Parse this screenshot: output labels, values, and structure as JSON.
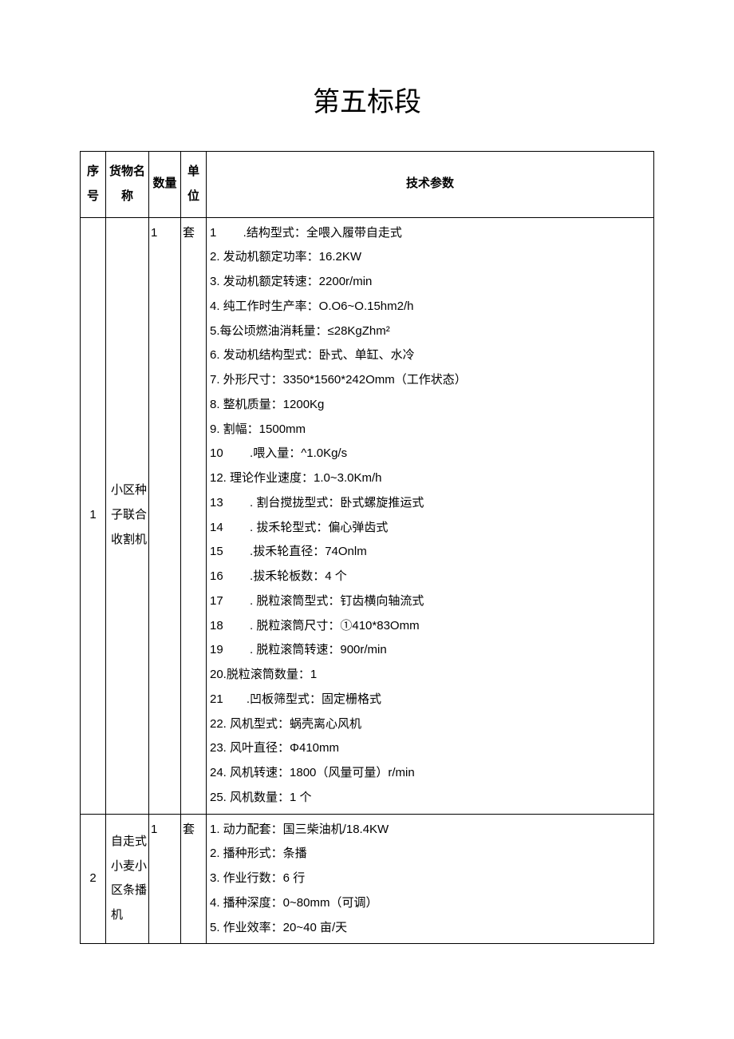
{
  "title": "第五标段",
  "headers": {
    "seq": "序号",
    "name": "货物名称",
    "qty": "数量",
    "unit": "单位",
    "spec": "技术参数"
  },
  "rows": [
    {
      "seq": "1",
      "name": "小区种子联合收割机",
      "qty": "1",
      "unit": "套",
      "specs": [
        "1        .结构型式：全喂入履带自走式",
        "2. 发动机额定功率：16.2KW",
        "3. 发动机额定转速：2200r/min",
        "4. 纯工作时生产率：O.O6~O.15hm2/h",
        "5.每公顷燃油消耗量：≤28KgZhm²",
        "6. 发动机结构型式：卧式、单缸、水冷",
        "7. 外形尺寸：3350*1560*242Omm（工作状态）",
        "8. 整机质量：1200Kg",
        "9. 割幅：1500mm",
        "10        .喂入量：^1.0Kg/s",
        "12. 理论作业速度：1.0~3.0Km/h",
        "13        . 割台搅拢型式：卧式螺旋推运式",
        "14        . 拔禾轮型式：偏心弹齿式",
        "15        .拔禾轮直径：74Onlm",
        "16        .拔禾轮板数：4 个",
        "17        . 脱粒滚筒型式：钉齿横向轴流式",
        "18        . 脱粒滚筒尺寸：①410*83Omm",
        "19        . 脱粒滚筒转速：900r/min",
        "20.脱粒滚筒数量：1",
        "21       .凹板筛型式：固定栅格式",
        "22. 风机型式：蜗壳离心风机",
        "23. 风叶直径：Φ410mm",
        "24. 风机转速：1800（风量可量）r/min",
        "25. 风机数量：1 个"
      ]
    },
    {
      "seq": "2",
      "name": "自走式小麦小区条播机",
      "qty": "1",
      "unit": "套",
      "specs": [
        "1. 动力配套：国三柴油机/18.4KW",
        "2. 播种形式：条播",
        "3. 作业行数：6 行",
        "4. 播种深度：0~80mm（可调）",
        "5. 作业效率：20~40 亩/天"
      ]
    }
  ]
}
